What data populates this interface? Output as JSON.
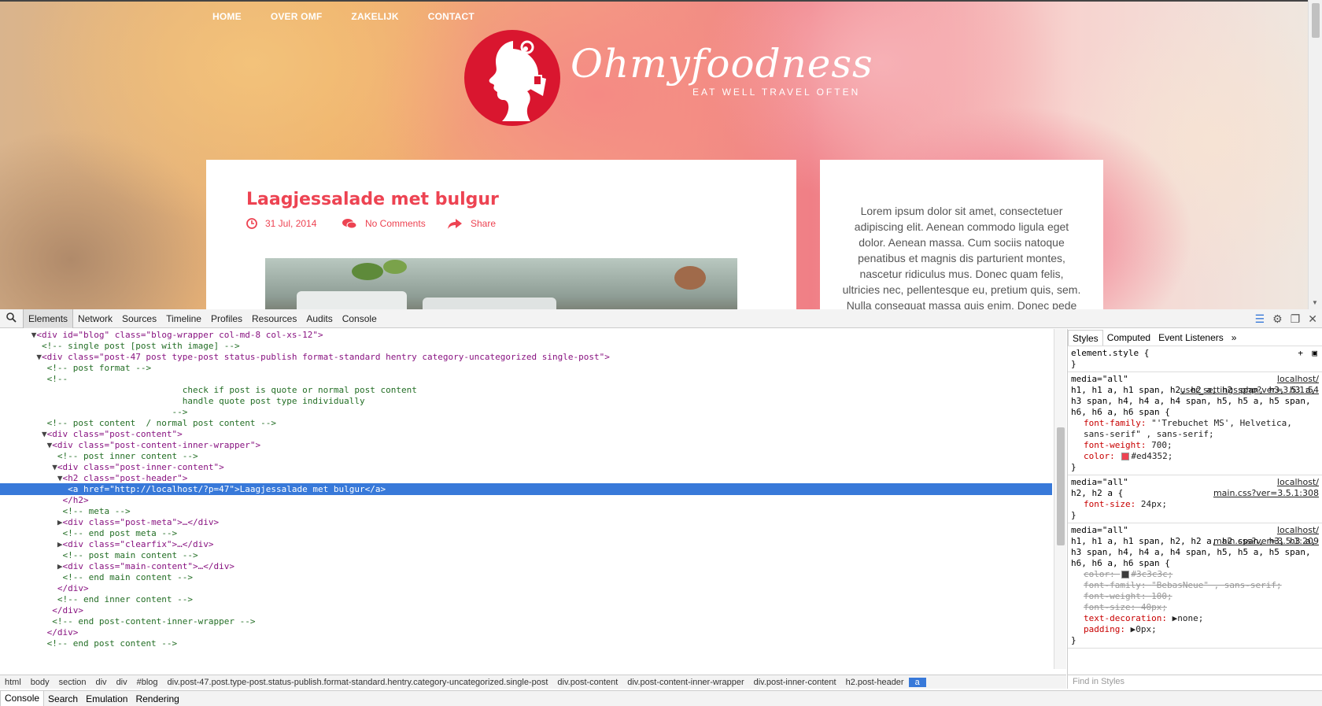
{
  "site": {
    "nav": [
      "HOME",
      "OVER OMF",
      "ZAKELIJK",
      "CONTACT"
    ],
    "logo_name": "Ohmyfoodness",
    "logo_tagline": "EAT WELL TRAVEL OFTEN",
    "post_title": "Laagjessalade met bulgur",
    "post_date": "31 Jul, 2014",
    "post_comments": "No Comments",
    "post_share": "Share",
    "sidebar_text": "Lorem ipsum dolor sit amet, consectetuer adipiscing elit. Aenean commodo ligula eget dolor. Aenean massa. Cum sociis natoque penatibus et magnis dis parturient montes, nascetur ridiculus mus. Donec quam felis, ultricies nec, pellentesque eu, pretium quis, sem. Nulla consequat massa quis enim. Donec pede"
  },
  "devtools": {
    "tabs": [
      "Elements",
      "Network",
      "Sources",
      "Timeline",
      "Profiles",
      "Resources",
      "Audits",
      "Console"
    ],
    "active_tab": "Elements",
    "lines": [
      {
        "indent": 6,
        "tri": "▼",
        "html": "&lt;div id=\"blog\" class=\"blog-wrapper col-md-8 col-xs-12\"&gt;",
        "kind": "tag"
      },
      {
        "indent": 8,
        "tri": "",
        "html": "&lt;!-- single post [post with image] --&gt;",
        "kind": "cmt"
      },
      {
        "indent": 7,
        "tri": "▼",
        "html": "&lt;div class=\"post-47 post type-post status-publish format-standard hentry category-uncategorized single-post\"&gt;",
        "kind": "tag"
      },
      {
        "indent": 9,
        "tri": "",
        "html": "&lt;!-- post format --&gt;",
        "kind": "cmt"
      },
      {
        "indent": 9,
        "tri": "",
        "html": "&lt;!--",
        "kind": "cmt"
      },
      {
        "indent": 35,
        "tri": "",
        "html": "check if post is quote or normal post content",
        "kind": "cmt"
      },
      {
        "indent": 35,
        "tri": "",
        "html": "handle quote post type individually",
        "kind": "cmt"
      },
      {
        "indent": 33,
        "tri": "",
        "html": "--&gt;",
        "kind": "cmt"
      },
      {
        "indent": 9,
        "tri": "",
        "html": "&lt;!-- post content  / normal post content --&gt;",
        "kind": "cmt"
      },
      {
        "indent": 8,
        "tri": "▼",
        "html": "&lt;div class=\"post-content\"&gt;",
        "kind": "tag"
      },
      {
        "indent": 9,
        "tri": "▼",
        "html": "&lt;div class=\"post-content-inner-wrapper\"&gt;",
        "kind": "tag"
      },
      {
        "indent": 11,
        "tri": "",
        "html": "&lt;!-- post inner content --&gt;",
        "kind": "cmt"
      },
      {
        "indent": 10,
        "tri": "▼",
        "html": "&lt;div class=\"post-inner-content\"&gt;",
        "kind": "tag"
      },
      {
        "indent": 11,
        "tri": "▼",
        "html": "&lt;h2 class=\"post-header\"&gt;",
        "kind": "tag"
      },
      {
        "indent": 13,
        "tri": "",
        "html": "&lt;a href=\"http://localhost/?p=47\"&gt;Laagjessalade met bulgur&lt;/a&gt;",
        "kind": "sel"
      },
      {
        "indent": 12,
        "tri": "",
        "html": "&lt;/h2&gt;",
        "kind": "tag"
      },
      {
        "indent": 12,
        "tri": "",
        "html": "&lt;!-- meta --&gt;",
        "kind": "cmt"
      },
      {
        "indent": 11,
        "tri": "▶",
        "html": "&lt;div class=\"post-meta\"&gt;…&lt;/div&gt;",
        "kind": "tag"
      },
      {
        "indent": 12,
        "tri": "",
        "html": "&lt;!-- end post meta --&gt;",
        "kind": "cmt"
      },
      {
        "indent": 11,
        "tri": "▶",
        "html": "&lt;div class=\"clearfix\"&gt;…&lt;/div&gt;",
        "kind": "tag"
      },
      {
        "indent": 12,
        "tri": "",
        "html": "&lt;!-- post main content --&gt;",
        "kind": "cmt"
      },
      {
        "indent": 11,
        "tri": "▶",
        "html": "&lt;div class=\"main-content\"&gt;…&lt;/div&gt;",
        "kind": "tag"
      },
      {
        "indent": 12,
        "tri": "",
        "html": "&lt;!-- end main content --&gt;",
        "kind": "cmt"
      },
      {
        "indent": 11,
        "tri": "",
        "html": "&lt;/div&gt;",
        "kind": "tag"
      },
      {
        "indent": 11,
        "tri": "",
        "html": "&lt;!-- end inner content --&gt;",
        "kind": "cmt"
      },
      {
        "indent": 10,
        "tri": "",
        "html": "&lt;/div&gt;",
        "kind": "tag"
      },
      {
        "indent": 10,
        "tri": "",
        "html": "&lt;!-- end post-content-inner-wrapper --&gt;",
        "kind": "cmt"
      },
      {
        "indent": 9,
        "tri": "",
        "html": "&lt;/div&gt;",
        "kind": "tag"
      },
      {
        "indent": 9,
        "tri": "",
        "html": "&lt;!-- end post content --&gt;",
        "kind": "cmt"
      }
    ],
    "breadcrumb": [
      "html",
      "body",
      "section",
      "div",
      "div",
      "#blog",
      "div.post-47.post.type-post.status-publish.format-standard.hentry.category-uncategorized.single-post",
      "div.post-content",
      "div.post-content-inner-wrapper",
      "div.post-inner-content",
      "h2.post-header",
      "a"
    ],
    "style_tabs": [
      "Styles",
      "Computed",
      "Event Listeners"
    ],
    "style_more": "»",
    "element_style": "element.style {",
    "element_style_close": "}",
    "rules": [
      {
        "media": "media=\"all\"",
        "src1": "localhost/",
        "src2": "user_settings.php?ver=3.5.1:54",
        "selector": "h1, h1 a, h1 span, h2, h2 a, h2 span, h3, h3 a, h3 span, h4, h4 a, h4 span, h5, h5 a, h5 span, h6, h6 a, h6 span {",
        "props": [
          {
            "name": "font-family",
            "value": "\"'Trebuchet MS', Helvetica, sans-serif\" , sans-serif;"
          },
          {
            "name": "font-weight",
            "value": "700;"
          },
          {
            "name": "color",
            "value": "#ed4352;",
            "swatch": "#ed4352"
          }
        ]
      },
      {
        "media": "media=\"all\"",
        "src1": "localhost/",
        "src2": "main.css?ver=3.5.1:308",
        "selector": "h2, h2 a {",
        "props": [
          {
            "name": "font-size",
            "value": "24px;"
          }
        ]
      },
      {
        "media": "media=\"all\"",
        "src1": "localhost/",
        "src2": "main.css?ver=3.5.1:209",
        "selector": "h1, h1 a, h1 span, h2, h2 a, h2 span, h3, h3 a, h3 span, h4, h4 a, h4 span, h5, h5 a, h5 span, h6, h6 a, h6 span {",
        "props": [
          {
            "name": "color",
            "value": "#3c3c3c;",
            "swatch": "#3c3c3c",
            "strike": true
          },
          {
            "name": "font-family",
            "value": "\"BebasNeue\" , sans-serif;",
            "strike": true
          },
          {
            "name": "font-weight",
            "value": "100;",
            "strike": true
          },
          {
            "name": "font-size",
            "value": "40px;",
            "strike": true
          },
          {
            "name": "text-decoration",
            "value": "▶none;"
          },
          {
            "name": "padding",
            "value": "▶0px;"
          }
        ]
      }
    ],
    "find_styles": "Find in Styles",
    "drawer_tabs": [
      "Console",
      "Search",
      "Emulation",
      "Rendering"
    ]
  }
}
